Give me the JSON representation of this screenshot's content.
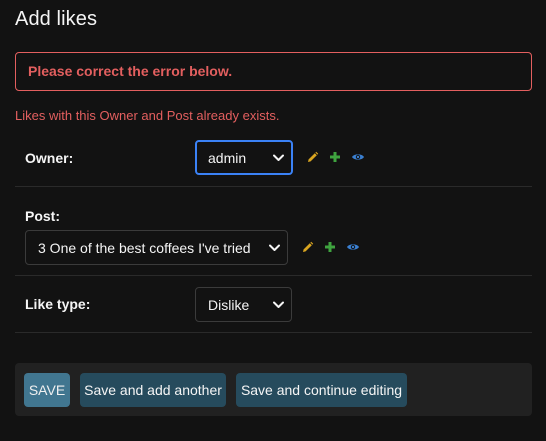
{
  "page": {
    "title": "Add likes"
  },
  "errors": {
    "note": "Please correct the error below.",
    "nonfield": "Likes with this Owner and Post already exists."
  },
  "fields": {
    "owner": {
      "label": "Owner:",
      "selected": "admin"
    },
    "post": {
      "label": "Post:",
      "selected": "3 One of the best coffees I've tried"
    },
    "like_type": {
      "label": "Like type:",
      "selected": "Dislike"
    }
  },
  "buttons": {
    "save": "SAVE",
    "save_add_another": "Save and add another",
    "save_continue": "Save and continue editing"
  },
  "icons": {
    "change": "pencil-icon",
    "add": "plus-icon",
    "view": "eye-icon"
  },
  "colors": {
    "error": "#e35f5f",
    "save_button": "#417690",
    "secondary_button": "#264b5d",
    "focus_border": "#3b82f6",
    "pencil": "#d9a520",
    "plus": "#3fa33f",
    "eye": "#3a7fd0"
  }
}
